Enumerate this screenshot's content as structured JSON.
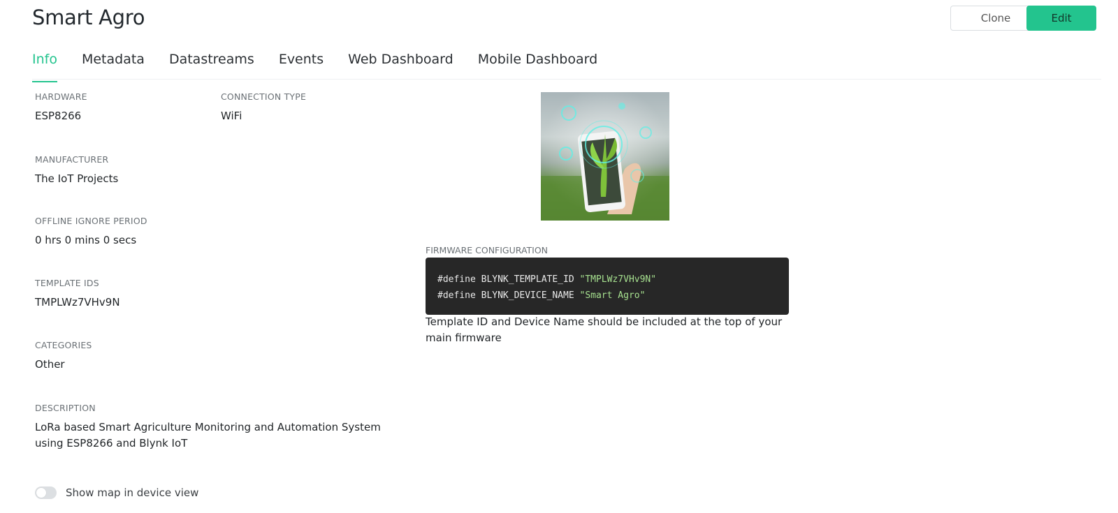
{
  "header": {
    "title": "Smart Agro",
    "clone_label": "Clone",
    "edit_label": "Edit"
  },
  "tabs": [
    {
      "label": "Info",
      "active": true
    },
    {
      "label": "Metadata",
      "active": false
    },
    {
      "label": "Datastreams",
      "active": false
    },
    {
      "label": "Events",
      "active": false
    },
    {
      "label": "Web Dashboard",
      "active": false
    },
    {
      "label": "Mobile Dashboard",
      "active": false
    }
  ],
  "info": {
    "hardware": {
      "label": "HARDWARE",
      "value": "ESP8266"
    },
    "connection_type": {
      "label": "CONNECTION TYPE",
      "value": "WiFi"
    },
    "manufacturer": {
      "label": "MANUFACTURER",
      "value": "The IoT Projects"
    },
    "offline_ignore_period": {
      "label": "OFFLINE IGNORE PERIOD",
      "value": "0 hrs 0 mins 0 secs"
    },
    "template_ids": {
      "label": "TEMPLATE IDS",
      "value": "TMPLWz7VHv9N"
    },
    "categories": {
      "label": "CATEGORIES",
      "value": "Other"
    },
    "description": {
      "label": "DESCRIPTION",
      "value": "LoRa based Smart Agriculture Monitoring and Automation System using ESP8266 and Blynk IoT"
    }
  },
  "firmware": {
    "label": "FIRMWARE CONFIGURATION",
    "line1_prefix": "#define BLYNK_TEMPLATE_ID ",
    "line1_value": "\"TMPLWz7VHv9N\"",
    "line2_prefix": "#define BLYNK_DEVICE_NAME ",
    "line2_value": "\"Smart Agro\"",
    "note": "Template ID and Device Name should be included at the top of your main firmware"
  },
  "map_toggle": {
    "label": "Show map in device view",
    "enabled": false
  },
  "colors": {
    "accent": "#23c48e",
    "code_bg": "#272727",
    "code_string": "#a6e08f"
  }
}
